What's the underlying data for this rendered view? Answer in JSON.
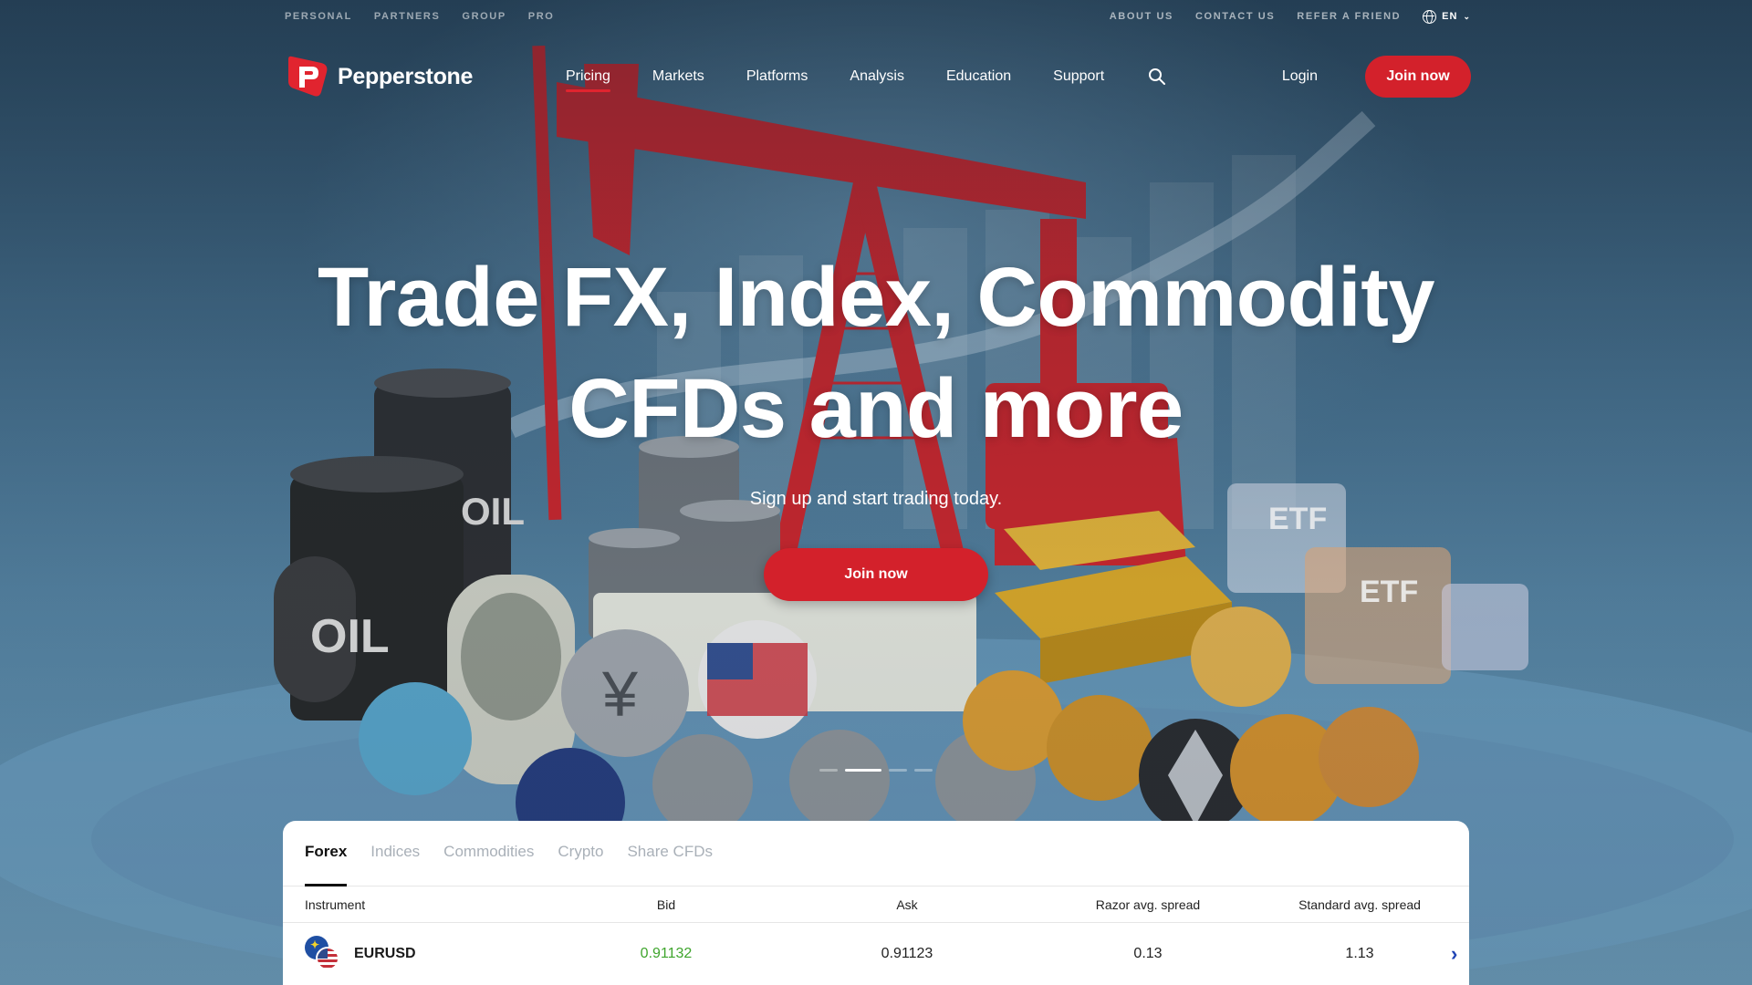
{
  "util_bar": {
    "left_links": [
      "PERSONAL",
      "PARTNERS",
      "GROUP",
      "PRO"
    ],
    "right_links": [
      "ABOUT US",
      "CONTACT US",
      "REFER A FRIEND"
    ],
    "language": "EN"
  },
  "nav": {
    "brand": "Pepperstone",
    "items": [
      "Pricing",
      "Markets",
      "Platforms",
      "Analysis",
      "Education",
      "Support"
    ],
    "active_item": "Pricing",
    "login": "Login",
    "join": "Join now"
  },
  "hero": {
    "title_line1": "Trade FX, Index, Commodity",
    "title_line2": "CFDs and more",
    "subtitle": "Sign up and start trading today.",
    "cta": "Join now",
    "slides_total": 4,
    "active_slide": 2
  },
  "rates": {
    "tabs": [
      "Forex",
      "Indices",
      "Commodities",
      "Crypto",
      "Share CFDs"
    ],
    "active_tab": "Forex",
    "columns": [
      "Instrument",
      "Bid",
      "Ask",
      "Razor avg. spread",
      "Standard avg. spread"
    ],
    "rows": [
      {
        "instrument": "EURUSD",
        "bid": "0.91132",
        "ask": "0.91123",
        "razor_spread": "0.13",
        "standard_spread": "1.13"
      }
    ]
  },
  "colors": {
    "brand_red": "#d3212b",
    "bid_green": "#3fa52d",
    "arrow_blue": "#2145b5"
  }
}
